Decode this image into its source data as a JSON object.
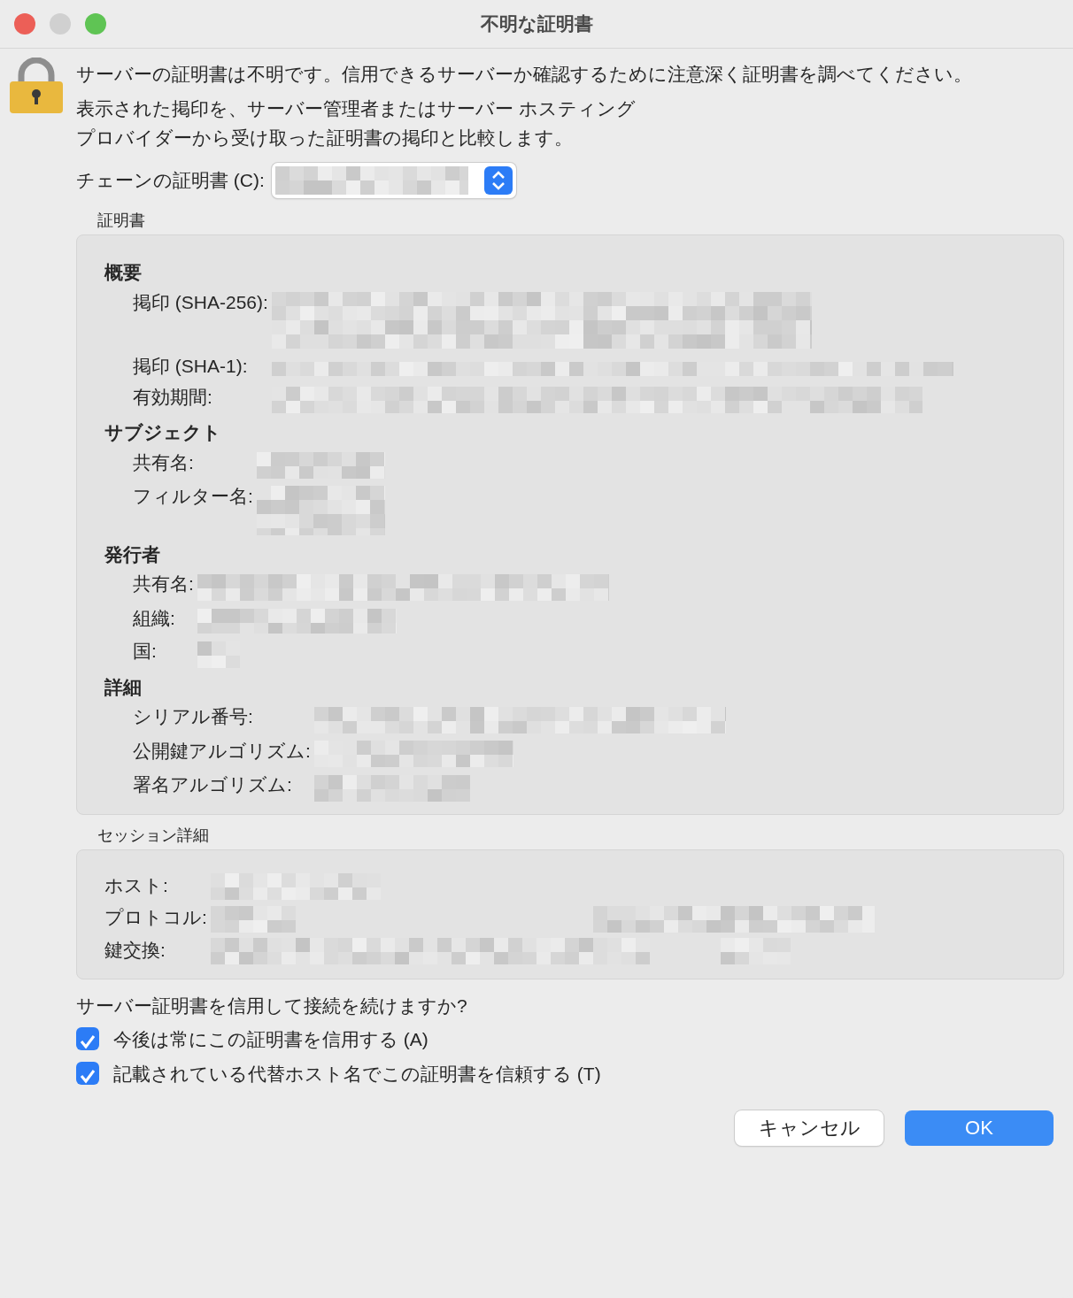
{
  "window": {
    "title": "不明な証明書"
  },
  "message": [
    "サーバーの証明書は不明です。信用できるサーバーか確認するために注意深く証明書を調べてください。",
    "表示された掲印を、サーバー管理者またはサーバー ホスティング",
    "プロバイダーから受け取った証明書の掲印と比較します。"
  ],
  "chain": {
    "label": "チェーンの証明書 (C):",
    "redacted": true
  },
  "certificate": {
    "title": "証明書",
    "sections": [
      {
        "heading": "概要",
        "fields": [
          {
            "label": "掲印 (SHA-256):",
            "redacted": true
          },
          {
            "label": "掲印 (SHA-1):",
            "redacted": true
          },
          {
            "label": "有効期間:",
            "redacted": true
          }
        ]
      },
      {
        "heading": "サブジェクト",
        "fields": [
          {
            "label": "共有名:",
            "redacted": true
          },
          {
            "label": "フィルター名:",
            "redacted": true
          }
        ]
      },
      {
        "heading": "発行者",
        "fields": [
          {
            "label": "共有名:",
            "redacted": true
          },
          {
            "label": "組織:",
            "redacted": true
          },
          {
            "label": "国:",
            "redacted": true
          }
        ]
      },
      {
        "heading": "詳細",
        "fields": [
          {
            "label": "シリアル番号:",
            "redacted": true
          },
          {
            "label": "公開鍵アルゴリズム:",
            "redacted": true
          },
          {
            "label": "署名アルゴリズム:",
            "redacted": true
          }
        ]
      }
    ]
  },
  "session": {
    "title": "セッション詳細",
    "fields": [
      {
        "label": "ホスト:",
        "redacted": true
      },
      {
        "label": "プロトコル:",
        "redacted": true
      },
      {
        "label": "鍵交換:",
        "redacted": true
      }
    ]
  },
  "question": "サーバー証明書を信用して接続を続けますか?",
  "options": [
    {
      "label": "今後は常にこの証明書を信用する (A)",
      "checked": true
    },
    {
      "label": "記載されている代替ホスト名でこの証明書を信頼する (T)",
      "checked": true
    }
  ],
  "buttons": [
    {
      "label": "キャンセル",
      "kind": "secondary"
    },
    {
      "label": "OK",
      "kind": "primary"
    }
  ]
}
